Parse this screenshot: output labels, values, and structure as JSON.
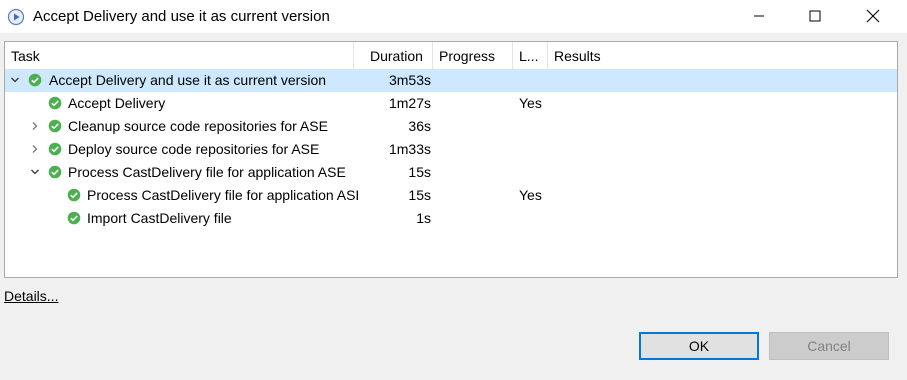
{
  "window": {
    "title": "Accept Delivery and use it as current version",
    "icon": "play-circle-icon"
  },
  "table": {
    "columns": [
      "Task",
      "Duration",
      "Progress",
      "L...",
      "Results"
    ],
    "rows": [
      {
        "task": "Accept Delivery and use it as current version",
        "duration": "3m53s",
        "l": "",
        "status": "success",
        "expander": "expanded",
        "selected": true
      },
      {
        "task": "Accept Delivery",
        "duration": "1m27s",
        "l": "Yes",
        "status": "success",
        "expander": "none",
        "selected": false
      },
      {
        "task": "Cleanup source code repositories for ASE",
        "duration": "36s",
        "l": "",
        "status": "success",
        "expander": "collapsed",
        "selected": false
      },
      {
        "task": "Deploy source code repositories for ASE",
        "duration": "1m33s",
        "l": "",
        "status": "success",
        "expander": "collapsed",
        "selected": false
      },
      {
        "task": "Process CastDelivery file for application ASE",
        "duration": "15s",
        "l": "",
        "status": "success",
        "expander": "expanded",
        "selected": false
      },
      {
        "task": "Process CastDelivery file for application ASE",
        "duration": "15s",
        "l": "Yes",
        "status": "success",
        "expander": "none",
        "selected": false
      },
      {
        "task": "Import CastDelivery file",
        "duration": "1s",
        "l": "",
        "status": "success",
        "expander": "none",
        "selected": false
      }
    ]
  },
  "details_link": "Details...",
  "buttons": {
    "ok": "OK",
    "cancel": "Cancel"
  },
  "colors": {
    "success": "#4caf50",
    "selection": "#cde8ff",
    "focus_border": "#0078d7"
  }
}
